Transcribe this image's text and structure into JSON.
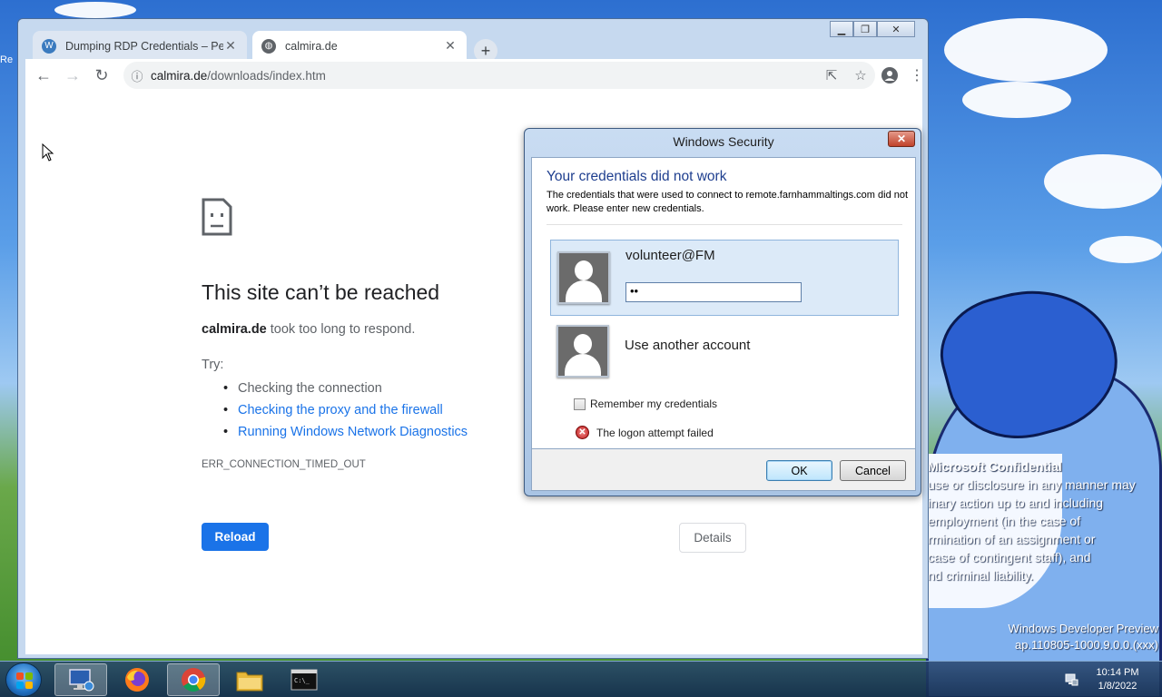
{
  "browser": {
    "tabs": [
      {
        "title": "Dumping RDP Credentials – Pene",
        "active": false,
        "icon": "wordpress-icon"
      },
      {
        "title": "calmira.de",
        "active": true,
        "icon": "globe-icon"
      }
    ],
    "url_host": "calmira.de",
    "url_path": "/downloads/index.htm"
  },
  "error_page": {
    "title": "This site can’t be reached",
    "host": "calmira.de",
    "desc_rest": " took too long to respond.",
    "try_label": "Try:",
    "suggestions": [
      "Checking the connection",
      "Checking the proxy and the firewall",
      "Running Windows Network Diagnostics"
    ],
    "error_code": "ERR_CONNECTION_TIMED_OUT",
    "reload_label": "Reload",
    "details_label": "Details"
  },
  "dialog": {
    "title": "Windows Security",
    "heading": "Your credentials did not work",
    "message": "The credentials that were used to connect to remote.farnhammaltings.com did not work. Please enter new credentials.",
    "username": "volunteer@FM",
    "password_value": "••",
    "other_account_label": "Use another account",
    "remember_label": "Remember my credentials",
    "remember_checked": false,
    "error_text": "The logon attempt failed",
    "ok_label": "OK",
    "cancel_label": "Cancel"
  },
  "desktop": {
    "watermark_title": "Microsoft Confidential",
    "watermark_lines": [
      "use or disclosure in any manner may",
      "inary action up to and including",
      "employment (in the case of",
      "rmination of an assignment or",
      "case of contingent staff), and",
      "nd criminal liability."
    ],
    "build_line1": "Windows Developer Preview",
    "build_line2": "ap.110805-1000.9.0.0.(xxx)",
    "left_edge_text": "Re"
  },
  "taskbar": {
    "items": [
      "remote-desktop-icon",
      "firefox-icon",
      "chrome-icon",
      "file-explorer-icon",
      "command-prompt-icon"
    ],
    "time": "10:14 PM",
    "date": "1/8/2022"
  },
  "colors": {
    "accent_blue": "#1a73e8",
    "dialog_heading": "#1f3f8f",
    "error_red": "#c01818"
  }
}
